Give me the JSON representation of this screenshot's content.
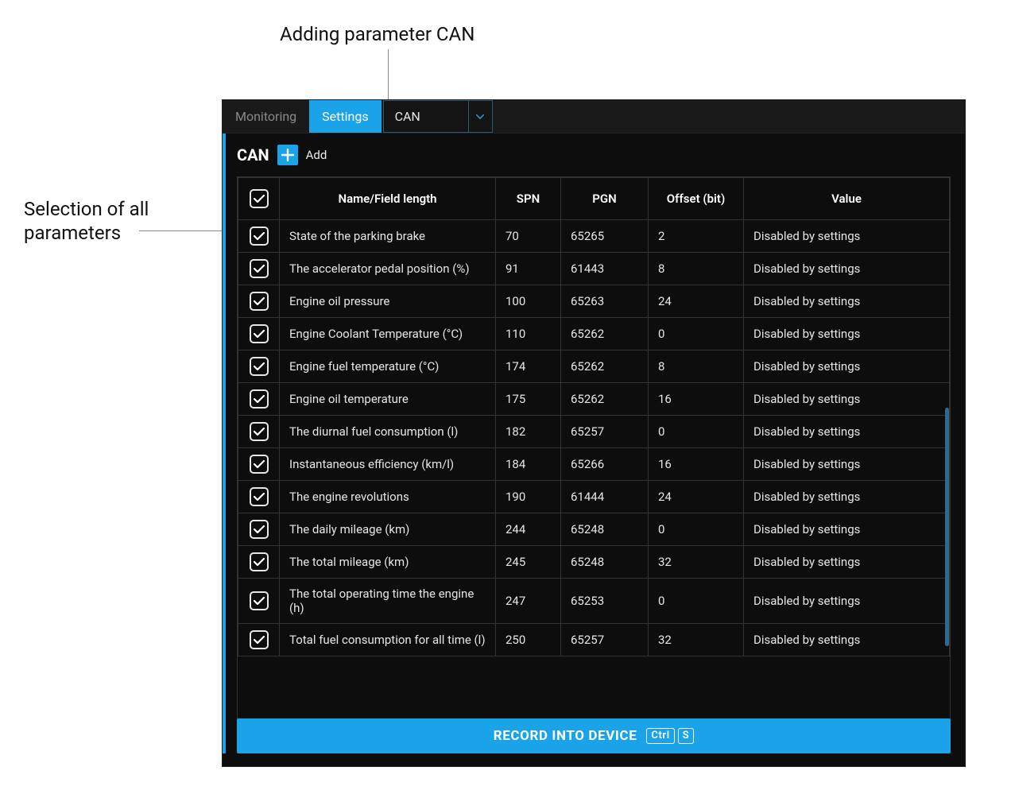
{
  "annotations": {
    "top": "Adding parameter CAN",
    "left_line1": "Selection of all",
    "left_line2": "parameters"
  },
  "tabs": {
    "monitoring": "Monitoring",
    "settings": "Settings"
  },
  "selector": {
    "value": "CAN"
  },
  "section": {
    "title": "CAN",
    "add_label": "Add"
  },
  "table": {
    "headers": {
      "name": "Name/Field length",
      "spn": "SPN",
      "pgn": "PGN",
      "offset": "Offset (bit)",
      "value": "Value"
    },
    "rows": [
      {
        "checked": true,
        "name": "State of the parking brake",
        "spn": "70",
        "pgn": "65265",
        "offset": "2",
        "value": "Disabled by settings"
      },
      {
        "checked": true,
        "name": "The accelerator pedal position (%)",
        "spn": "91",
        "pgn": "61443",
        "offset": "8",
        "value": "Disabled by settings"
      },
      {
        "checked": true,
        "name": "Engine oil pressure",
        "spn": "100",
        "pgn": "65263",
        "offset": "24",
        "value": "Disabled by settings"
      },
      {
        "checked": true,
        "name": "Engine Coolant Temperature (°C)",
        "spn": "110",
        "pgn": "65262",
        "offset": "0",
        "value": "Disabled by settings"
      },
      {
        "checked": true,
        "name": "Engine fuel temperature (°C)",
        "spn": "174",
        "pgn": "65262",
        "offset": "8",
        "value": "Disabled by settings"
      },
      {
        "checked": true,
        "name": "Engine oil temperature",
        "spn": "175",
        "pgn": "65262",
        "offset": "16",
        "value": "Disabled by settings"
      },
      {
        "checked": true,
        "name": "The diurnal fuel consumption (l)",
        "spn": "182",
        "pgn": "65257",
        "offset": "0",
        "value": "Disabled by settings"
      },
      {
        "checked": true,
        "name": "Instantaneous efficiency (km/l)",
        "spn": "184",
        "pgn": "65266",
        "offset": "16",
        "value": "Disabled by settings"
      },
      {
        "checked": true,
        "name": "The engine revolutions",
        "spn": "190",
        "pgn": "61444",
        "offset": "24",
        "value": "Disabled by settings"
      },
      {
        "checked": true,
        "name": "The daily mileage (km)",
        "spn": "244",
        "pgn": "65248",
        "offset": "0",
        "value": "Disabled by settings"
      },
      {
        "checked": true,
        "name": "The total mileage (km)",
        "spn": "245",
        "pgn": "65248",
        "offset": "32",
        "value": "Disabled by settings"
      },
      {
        "checked": true,
        "name": "The total operating time the engine (h)",
        "spn": "247",
        "pgn": "65253",
        "offset": "0",
        "value": "Disabled by settings"
      },
      {
        "checked": true,
        "name": "Total fuel consumption for all time (l)",
        "spn": "250",
        "pgn": "65257",
        "offset": "32",
        "value": "Disabled by settings"
      }
    ]
  },
  "record": {
    "label": "RECORD INTO DEVICE",
    "kbd1": "Ctrl",
    "kbd2": "S"
  }
}
